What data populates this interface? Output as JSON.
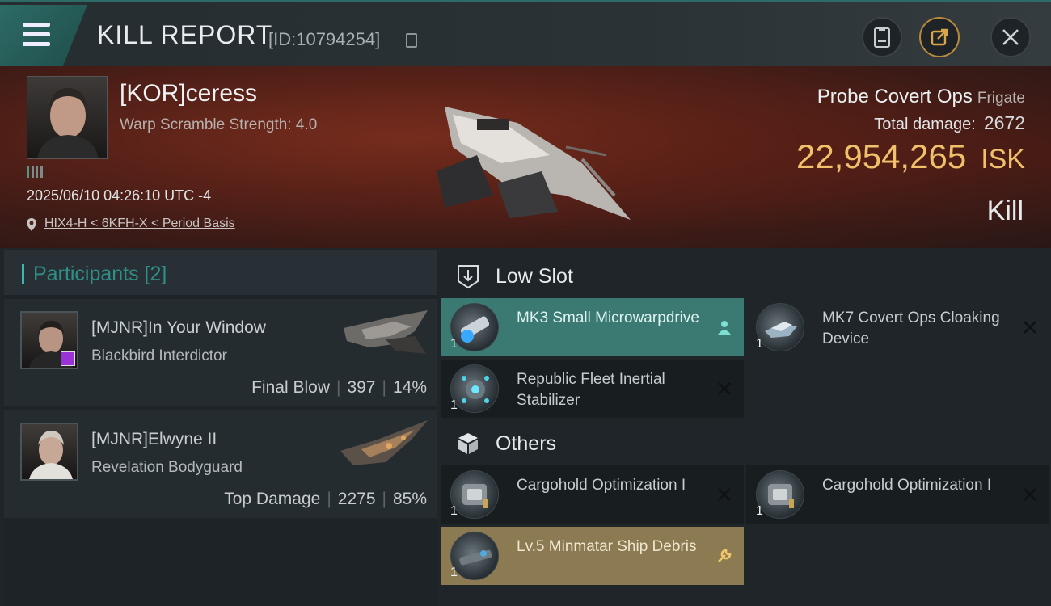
{
  "header": {
    "title": "KILL REPORT",
    "report_id": "[ID:10794254]",
    "icons": [
      "menu-icon",
      "copy-icon",
      "clipboard-icon",
      "share-icon",
      "close-icon"
    ]
  },
  "victim": {
    "name": "[KOR]ceress",
    "warp_scramble": "Warp Scramble Strength: 4.0",
    "datetime": "2025/06/10 04:26:10 UTC -4",
    "location": "HIX4-H < 6KFH-X < Period Basis",
    "ship_name": "Probe Covert Ops",
    "ship_class": "Frigate",
    "damage_label": "Total damage:",
    "damage_value": "2672",
    "isk_value": "22,954,265",
    "isk_unit": "ISK",
    "kill_type": "Kill"
  },
  "participants": {
    "header": "Participants [2]",
    "items": [
      {
        "name": "[MJNR]In Your Window",
        "ship": "Blackbird Interdictor",
        "label": "Final Blow",
        "damage": "397",
        "percent": "14%"
      },
      {
        "name": "[MJNR]Elwyne II",
        "ship": "Revelation Bodyguard",
        "label": "Top Damage",
        "damage": "2275",
        "percent": "85%"
      }
    ]
  },
  "sections": {
    "low_slot": "Low Slot",
    "others": "Others"
  },
  "modules": {
    "low": [
      {
        "name": "MK3 Small Microwarpdrive",
        "qty": "1",
        "status": "dropped"
      },
      {
        "name": "MK7 Covert Ops Cloaking Device",
        "qty": "1",
        "status": "destroyed"
      },
      {
        "name": "Republic Fleet Inertial Stabilizer",
        "qty": "1",
        "status": "destroyed"
      }
    ],
    "others": [
      {
        "name": "Cargohold Optimization I",
        "qty": "1",
        "status": "destroyed"
      },
      {
        "name": "Cargohold Optimization I",
        "qty": "1",
        "status": "destroyed"
      },
      {
        "name": "Lv.5 Minmatar Ship Debris",
        "qty": "1",
        "status": "salvage"
      }
    ]
  },
  "colors": {
    "accent": "#3fb6ad",
    "isk": "#f1c06a",
    "selected": "#3b7a73",
    "gold": "#8c7b52"
  }
}
